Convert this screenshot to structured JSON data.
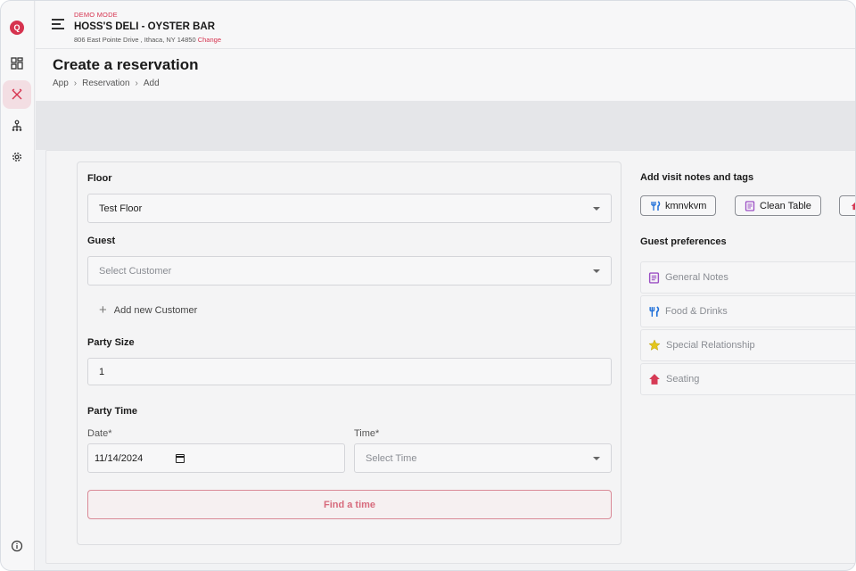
{
  "header": {
    "mode": "DEMO MODE",
    "restaurant_name": "HOSS'S DELI - OYSTER BAR",
    "address": "806 East Pointe Drive , Ithaca, NY 14850",
    "change_label": "Change"
  },
  "page": {
    "title": "Create a reservation",
    "breadcrumbs": [
      "App",
      "Reservation",
      "Add"
    ]
  },
  "sidebar": {
    "items": [
      {
        "icon": "app-logo-icon",
        "active": false
      },
      {
        "icon": "dashboard-icon",
        "active": false
      },
      {
        "icon": "utensils-icon",
        "active": true
      },
      {
        "icon": "org-chart-icon",
        "active": false
      },
      {
        "icon": "gear-icon",
        "active": false
      },
      {
        "icon": "info-icon",
        "active": false
      }
    ]
  },
  "form": {
    "floor_label": "Floor",
    "floor_value": "Test Floor",
    "guest_label": "Guest",
    "guest_placeholder": "Select Customer",
    "add_customer_label": "Add new Customer",
    "party_size_label": "Party Size",
    "party_size_value": "1",
    "party_time_label": "Party Time",
    "date_label": "Date*",
    "date_value": "11/14/2024",
    "time_label": "Time*",
    "time_placeholder": "Select Time",
    "find_button": "Find a time"
  },
  "notes": {
    "title": "Add visit notes and tags",
    "tags": [
      {
        "label": "kmnvkvm",
        "icon": "fork-knife-icon"
      },
      {
        "label": "Clean Table",
        "icon": "notes-icon"
      }
    ]
  },
  "preferences": {
    "title": "Guest preferences",
    "items": [
      {
        "label": "General Notes",
        "icon": "notes-icon"
      },
      {
        "label": "Food & Drinks",
        "icon": "fork-knife-icon"
      },
      {
        "label": "Special Relationship",
        "icon": "star-icon"
      },
      {
        "label": "Seating",
        "icon": "house-icon"
      }
    ]
  },
  "colors": {
    "accent": "#d6334f",
    "active_nav_bg": "#f3dee3",
    "food_icon": "#1e6fd9",
    "notes_icon": "#9b4fc4",
    "star_icon": "#e3c51b",
    "seating_icon": "#d63a55"
  }
}
